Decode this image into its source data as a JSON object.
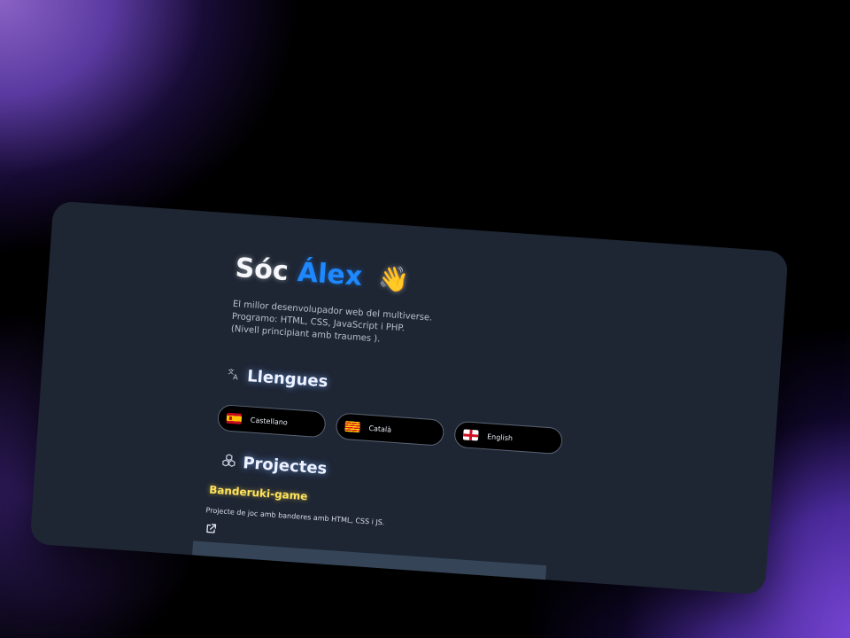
{
  "hero": {
    "greeting": "Sóc",
    "name": "Álex",
    "wave_icon": "waving-hand-icon",
    "intro_lines": [
      "El millor desenvolupador web del multiverse.",
      "Programo: HTML, CSS, JavaScript i PHP.",
      "(Nivell principiant amb traumes )."
    ]
  },
  "languages": {
    "title": "Llengues",
    "icon": "translate-icon",
    "items": [
      {
        "label": "Castellano",
        "flag": "flag-spain-icon"
      },
      {
        "label": "Català",
        "flag": "flag-catalonia-icon"
      },
      {
        "label": "English",
        "flag": "flag-england-icon"
      }
    ]
  },
  "projects": {
    "title": "Projectes",
    "icon": "cubes-icon",
    "items": [
      {
        "name": "Banderuki-game",
        "description": "Projecte de joc amb banderes amb HTML, CSS i JS.",
        "link_icon": "external-link-icon"
      }
    ]
  },
  "colors": {
    "card_bg": "#1e2634",
    "name_accent": "#1e88ff",
    "project_title": "#ffe45c"
  }
}
